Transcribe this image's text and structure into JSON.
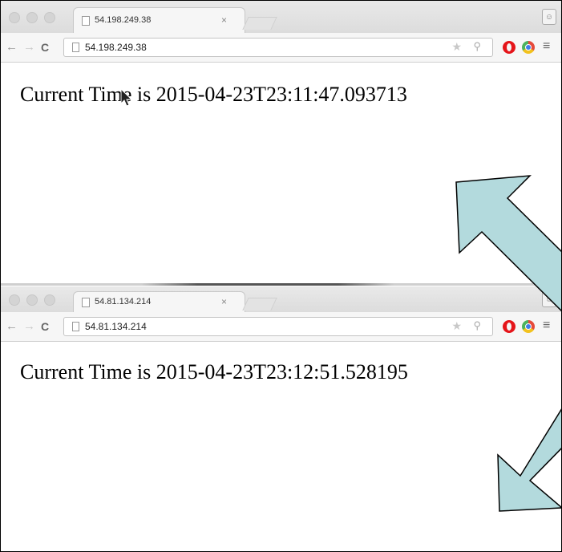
{
  "windows": [
    {
      "tab_title": "54.198.249.38",
      "tab_close": "×",
      "address": "54.198.249.38",
      "page_text": "Current Time is 2015-04-23T23:11:47.093713"
    },
    {
      "tab_title": "54.81.134.214",
      "tab_close": "×",
      "address": "54.81.134.214",
      "page_text": "Current Time is 2015-04-23T23:12:51.528195"
    }
  ],
  "icons": {
    "back": "arrow-left-icon",
    "forward": "arrow-right-icon",
    "reload": "reload-icon",
    "star": "star-icon",
    "zoom": "magnifier-icon",
    "menu": "hamburger-icon"
  },
  "colors": {
    "arrow_fill": "#b3dadd",
    "arrow_stroke": "#000000"
  }
}
